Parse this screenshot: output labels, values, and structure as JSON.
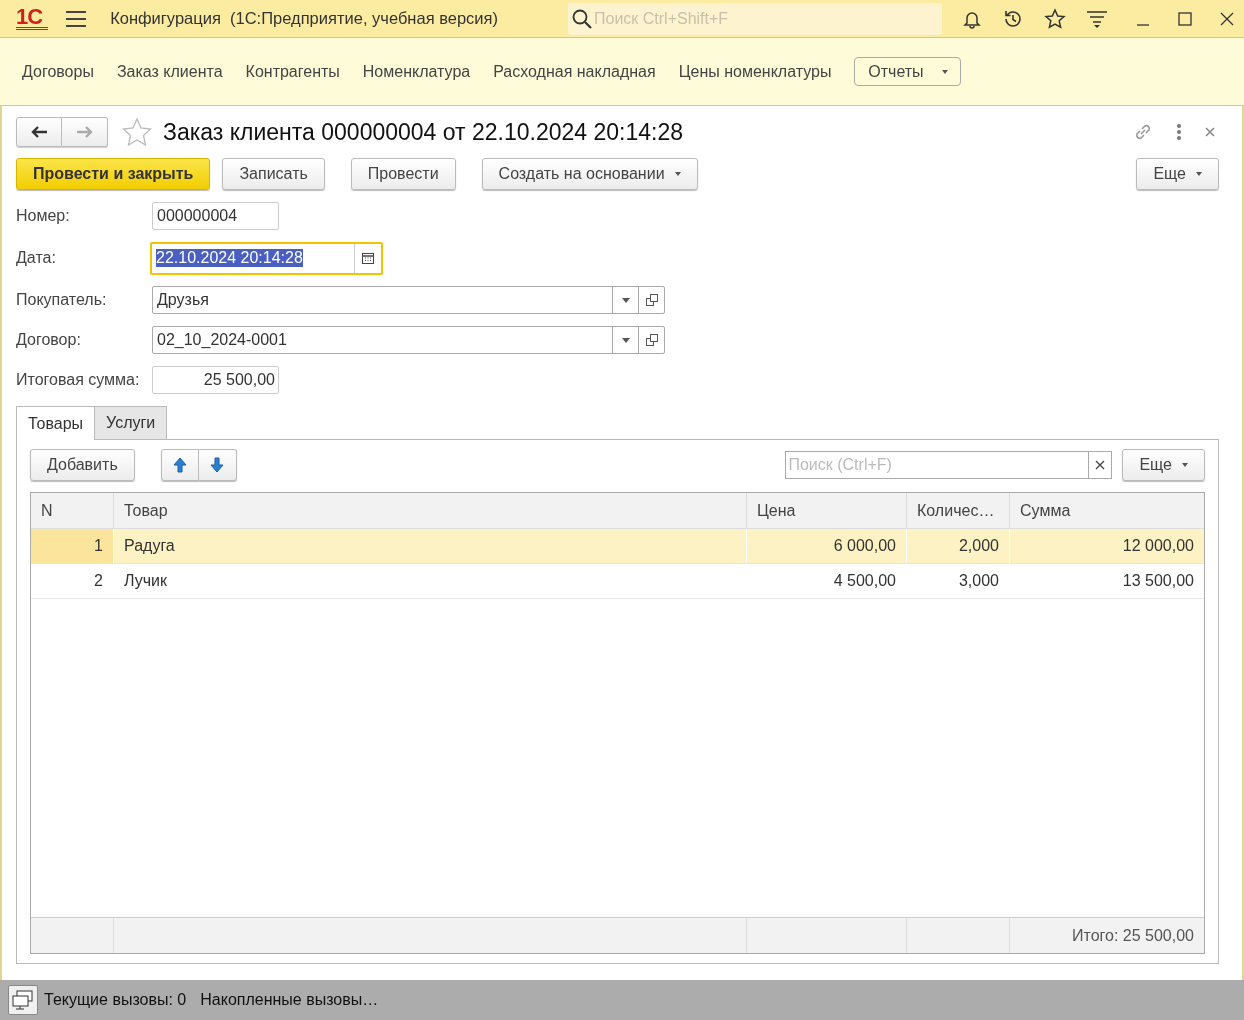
{
  "app": {
    "logo": "1С",
    "title": "Конфигурация  (1С:Предприятие, учебная версия)",
    "search": {
      "placeholder": "Поиск Ctrl+Shift+F"
    }
  },
  "sections": [
    "Договоры",
    "Заказ клиента",
    "Контрагенты",
    "Номенклатура",
    "Расходная накладная",
    "Цены номенклатуры"
  ],
  "reports_button": "Отчеты",
  "form": {
    "title": "Заказ клиента 000000004 от 22.10.2024 20:14:28",
    "favorite": false,
    "navigation": {
      "back_disabled": false,
      "forward_disabled": true
    },
    "buttons": [
      {
        "label": "Провести и закрыть",
        "kind": "primary"
      },
      {
        "label": "Записать",
        "kind": "plain"
      },
      {
        "label": "Провести",
        "kind": "plain"
      },
      {
        "label": "Создать на основании",
        "kind": "dropdown"
      }
    ],
    "more_button": "Еще",
    "fields": [
      {
        "label": "Номер:",
        "value": "000000004",
        "kind": "text",
        "focused": false
      },
      {
        "label": "Дата:",
        "value": "22.10.2024 20:14:28",
        "kind": "date",
        "focused": true
      },
      {
        "label": "Покупатель:",
        "value": "Друзья",
        "kind": "ref",
        "focused": false
      },
      {
        "label": "Договор:",
        "value": "02_10_2024-0001",
        "kind": "ref",
        "focused": false
      },
      {
        "label": "Итоговая сумма:",
        "value": "25 500,00",
        "kind": "number",
        "focused": false
      }
    ],
    "tabs": [
      {
        "label": "Товары",
        "selected": true
      },
      {
        "label": "Услуги",
        "selected": false
      }
    ],
    "table_toolbar": {
      "add_button": "Добавить",
      "search": {
        "placeholder": "Поиск (Ctrl+F)"
      },
      "more_button": "Еще"
    },
    "table": {
      "columns": [
        "N",
        "Товар",
        "Цена",
        "Количес…",
        "Сумма"
      ],
      "rows": [
        {
          "cells": [
            "1",
            "Радуга",
            "6 000,00",
            "2,000",
            "12 000,00"
          ],
          "selected": true
        },
        {
          "cells": [
            "2",
            "Лучик",
            "4 500,00",
            "3,000",
            "13 500,00"
          ],
          "selected": false
        }
      ],
      "footer": "Итого: 25 500,00"
    }
  },
  "status_bar": {
    "current_calls": "Текущие вызовы: 0",
    "accumulated_calls": "Накопленные вызовы…"
  }
}
